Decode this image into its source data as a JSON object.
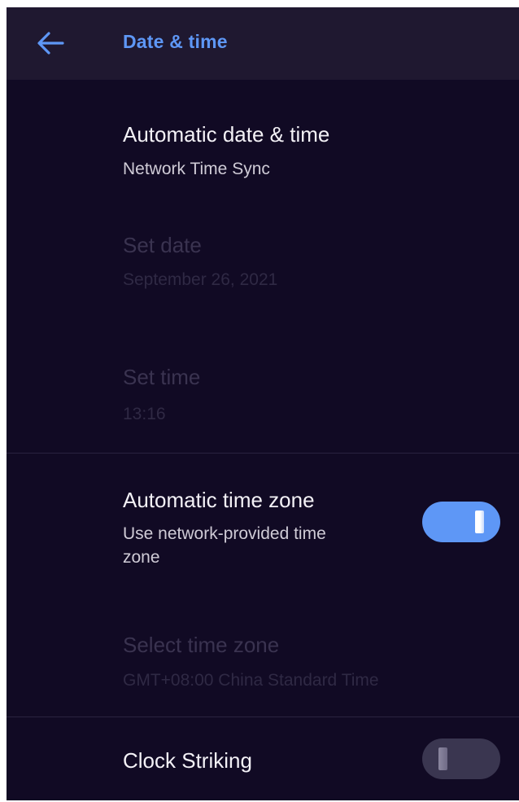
{
  "appbar": {
    "title": "Date & time",
    "back_icon": "arrow-left-icon"
  },
  "settings": {
    "auto_datetime": {
      "title": "Automatic date & time",
      "summary": "Network Time Sync"
    },
    "set_date": {
      "title": "Set date",
      "summary": "September 26, 2021"
    },
    "set_time": {
      "title": "Set time",
      "summary": "13:16"
    },
    "auto_timezone": {
      "title": "Automatic time zone",
      "summary_line1": "Use network-provided time",
      "summary_line2": "zone",
      "enabled": true
    },
    "select_timezone": {
      "title": "Select time zone",
      "summary": "GMT+08:00 China Standard Time"
    },
    "clock_striking": {
      "title": "Clock Striking",
      "enabled": false
    }
  },
  "colors": {
    "background": "#110a24",
    "appbar": "#1f1830",
    "accent": "#5e97f6",
    "switch_off": "#3a3650"
  }
}
